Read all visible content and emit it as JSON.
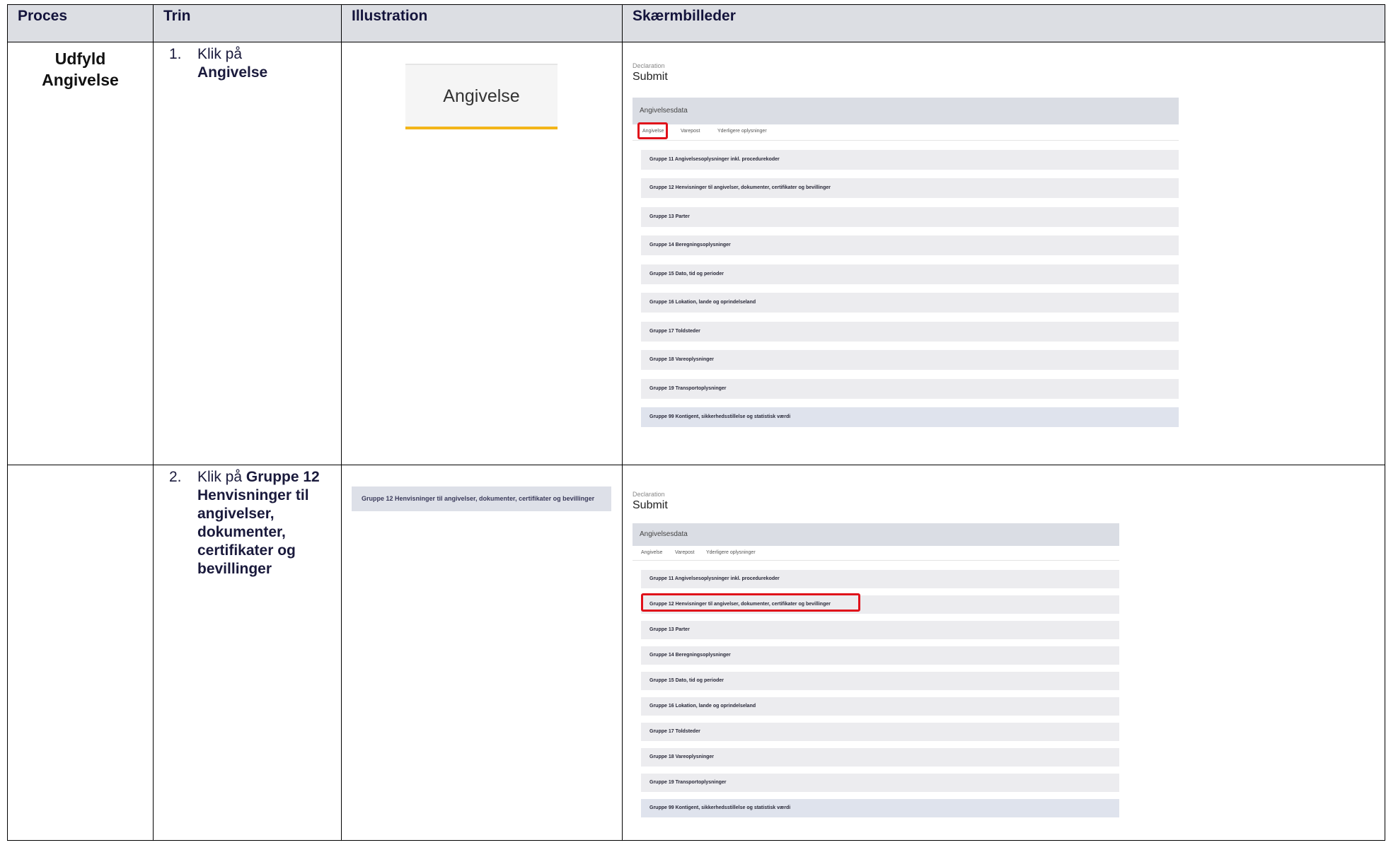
{
  "headers": {
    "proces": "Proces",
    "trin": "Trin",
    "illustration": "Illustration",
    "skaermbilleder": "Skærmbilleder"
  },
  "rows": [
    {
      "proces": "Udfyld Angivelse",
      "step_num": "1.",
      "step_prefix": "Klik på",
      "step_bold": "Angivelse",
      "illustration_label": "Angivelse",
      "accent_color": "#f3b519"
    },
    {
      "proces": "",
      "step_num": "2.",
      "step_prefix": "Klik på",
      "step_bold": "Gruppe 12 Henvisninger til angivelser, dokumenter, certifikater og bevillinger",
      "illustration_label": "Gruppe 12 Henvisninger til angivelser, dokumenter, certifikater og bevillinger"
    }
  ],
  "screenshot": {
    "declaration_label": "Declaration",
    "submit_label": "Submit",
    "panel_title": "Angivelsesdata",
    "tabs": [
      "Angivelse",
      "Varepost",
      "Yderligere oplysninger"
    ],
    "groups": [
      "Gruppe 11 Angivelsesoplysninger inkl. procedurekoder",
      "Gruppe 12 Henvisninger til angivelser, dokumenter, certifikater og bevillinger",
      "Gruppe 13 Parter",
      "Gruppe 14 Beregningsoplysninger",
      "Gruppe 15 Dato, tid og perioder",
      "Gruppe 16 Lokation, lande og oprindelseland",
      "Gruppe 17 Toldsteder",
      "Gruppe 18 Vareoplysninger",
      "Gruppe 19 Transportoplysninger",
      "Gruppe 99 Kontigent, sikkerhedsstillelse og statistisk værdi"
    ],
    "highlight_color": "#e0101a"
  }
}
